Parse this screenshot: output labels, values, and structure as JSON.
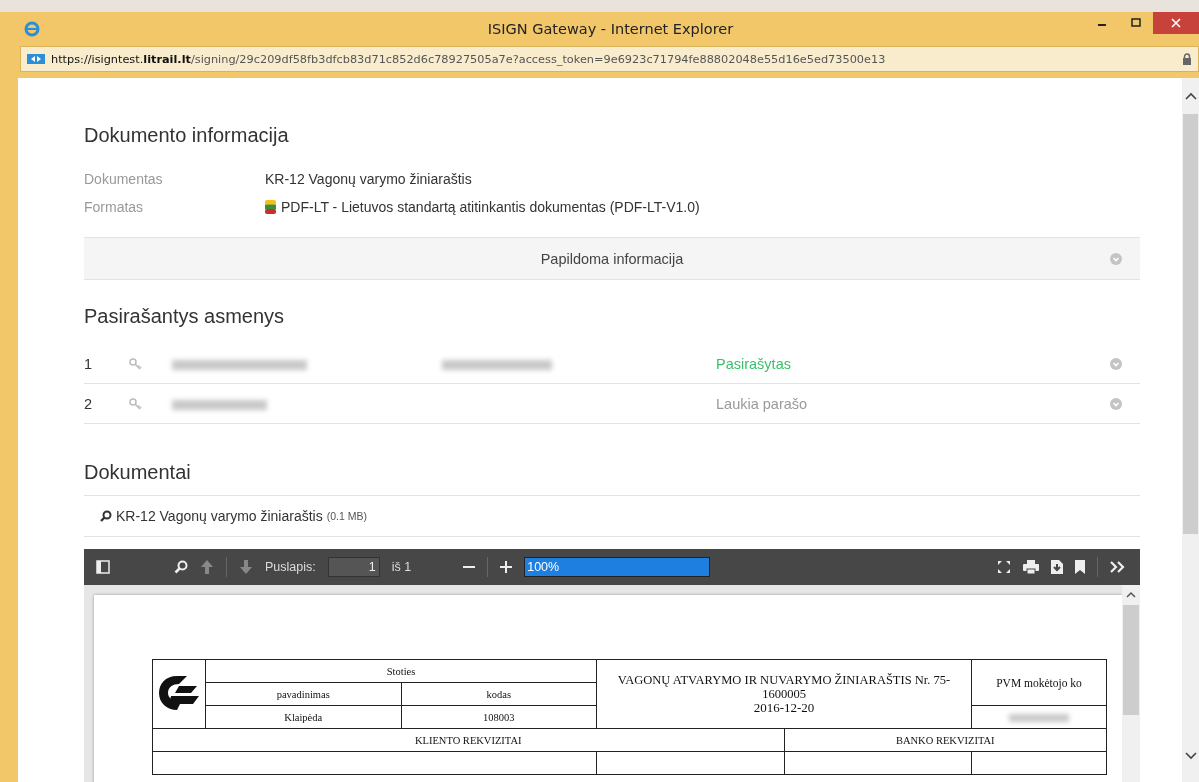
{
  "window": {
    "title": "ISIGN Gateway - Internet Explorer"
  },
  "address_bar": {
    "prefix": "https://isigntest.",
    "domain": "litrail.lt",
    "path": "/signing/29c209df58fb3dfcb83d71c852d6c78927505a7e?access_token=9e6923c71794fe88802048e55d16e5ed73500e13"
  },
  "document_info": {
    "title": "Dokumento informacija",
    "fields": [
      {
        "label": "Dokumentas",
        "value": "KR-12 Vagonų varymo žiniaraštis",
        "kind": "text"
      },
      {
        "label": "Formatas",
        "value": "PDF-LT - Lietuvos standartą atitinkantis dokumentas (PDF-LT-V1.0)",
        "kind": "format"
      }
    ],
    "more_info": {
      "label": "Papildoma informacija",
      "expanded": false
    }
  },
  "signers": {
    "title": "Pasirašantys asmenys",
    "rows": [
      {
        "number": "1",
        "status": "Pasirašytas",
        "signed": true,
        "has_email": true
      },
      {
        "number": "2",
        "status": "Laukia parašo",
        "signed": false,
        "has_email": false
      }
    ]
  },
  "documents": {
    "title": "Dokumentai",
    "items": [
      {
        "name": "KR-12 Vagonų varymo žiniaraštis",
        "size": "(0.1 MB)"
      }
    ]
  },
  "pdf_viewer": {
    "page_label": "Puslapis:",
    "page": "1",
    "page_total": "iš 1",
    "zoom": "100%",
    "table": {
      "station_header": "Stoties",
      "name_header": "pavadinimas",
      "code_header": "kodas",
      "station_name": "Klaipėda",
      "station_code": "108003",
      "title_lines": [
        "VAGONŲ ATVARYMO IR NUVARYMO ŽINIARAŠTIS Nr. 75-",
        "1600005",
        "2016-12-20"
      ],
      "vat_header": "PVM mokėtojo ko",
      "client_header": "KLIENTO REKVIZITAI",
      "bank_header": "BANKO REKVIZITAI"
    }
  }
}
